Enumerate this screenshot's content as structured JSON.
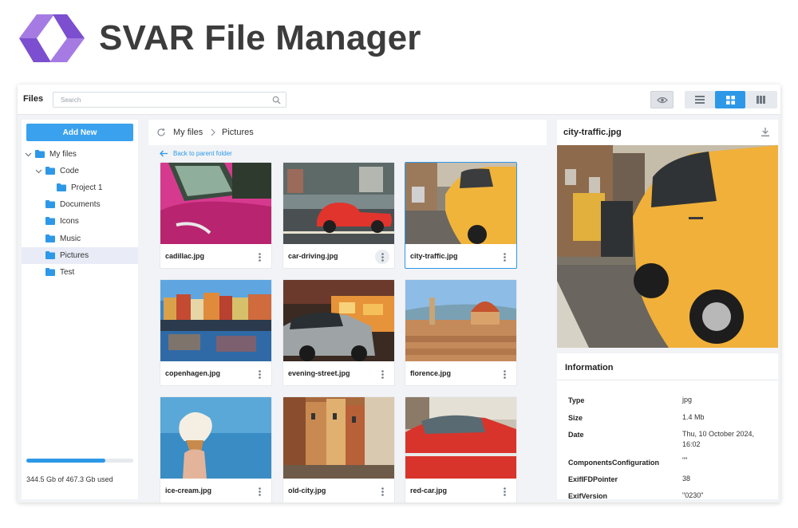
{
  "brand": {
    "title": "SVAR File Manager"
  },
  "toolbar": {
    "title": "Files",
    "search_placeholder": "Search",
    "icons": [
      "search-icon",
      "eye-icon",
      "list-view-icon",
      "grid-view-icon",
      "columns-view-icon"
    ],
    "active_view": "grid"
  },
  "sidebar": {
    "add_new": "Add New",
    "tree": [
      {
        "label": "My files",
        "level": 0,
        "expanded": true
      },
      {
        "label": "Code",
        "level": 1,
        "expanded": true
      },
      {
        "label": "Project 1",
        "level": 2
      },
      {
        "label": "Documents",
        "level": 1
      },
      {
        "label": "Icons",
        "level": 1
      },
      {
        "label": "Music",
        "level": 1
      },
      {
        "label": "Pictures",
        "level": 1,
        "selected": true
      },
      {
        "label": "Test",
        "level": 1
      }
    ],
    "usage_text": "344.5 Gb of 467.3 Gb used",
    "usage_fraction": 0.737
  },
  "main": {
    "breadcrumb": [
      "My files",
      "Pictures"
    ],
    "back_link": "Back to parent folder",
    "files": [
      {
        "name": "cadillac.jpg"
      },
      {
        "name": "car-driving.jpg"
      },
      {
        "name": "city-traffic.jpg",
        "selected": true
      },
      {
        "name": "copenhagen.jpg"
      },
      {
        "name": "evening-street.jpg"
      },
      {
        "name": "florence.jpg"
      },
      {
        "name": "ice-cream.jpg"
      },
      {
        "name": "old-city.jpg"
      },
      {
        "name": "red-car.jpg"
      }
    ]
  },
  "preview": {
    "file_name": "city-traffic.jpg",
    "info_title": "Information",
    "info": [
      {
        "key": "Type",
        "value": "jpg"
      },
      {
        "key": "Size",
        "value": "1.4 Mb"
      },
      {
        "key": "Date",
        "value": "Thu, 10 October 2024, 16:02"
      },
      {
        "key": "ComponentsConfiguration",
        "value": "\"\""
      },
      {
        "key": "ExifIFDPointer",
        "value": "38"
      },
      {
        "key": "ExifVersion",
        "value": "\"0230\""
      }
    ]
  },
  "colors": {
    "accent": "#2e98e8",
    "add_button": "#39a1ee",
    "brand_logo": "#8b5cd6",
    "selected_row": "#e9ecf7"
  }
}
